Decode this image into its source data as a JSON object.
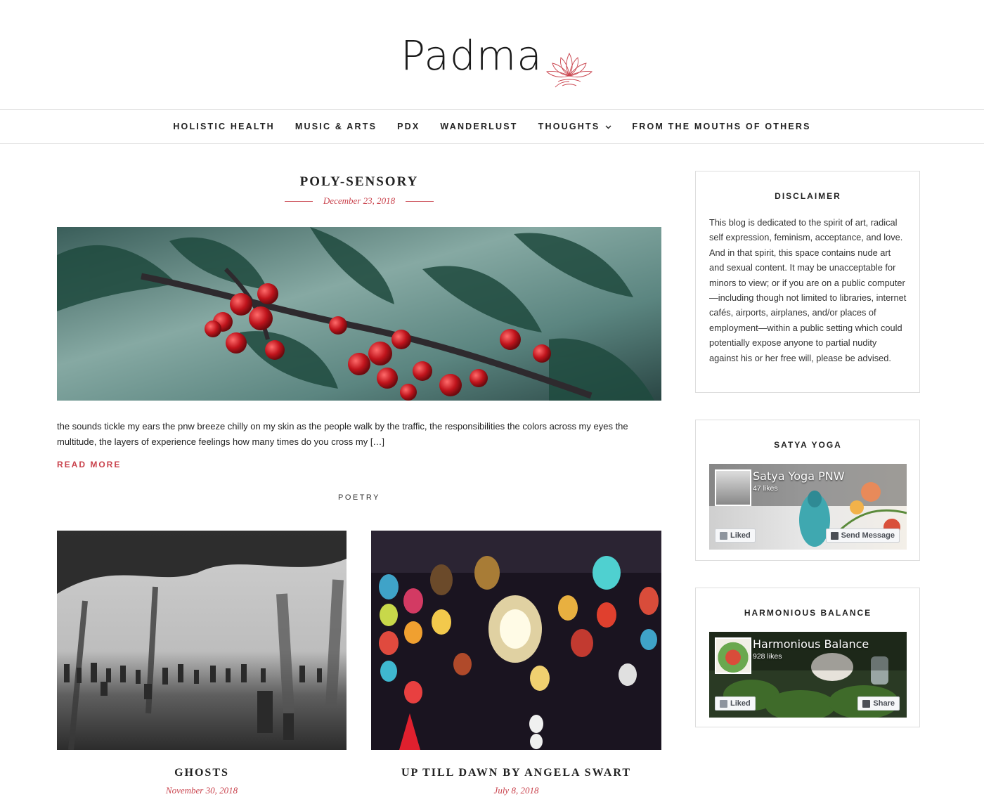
{
  "site": {
    "logo_text": "Padma"
  },
  "nav": {
    "items": [
      {
        "label": "HOLISTIC HEALTH"
      },
      {
        "label": "MUSIC & ARTS"
      },
      {
        "label": "PDX"
      },
      {
        "label": "WANDERLUST"
      },
      {
        "label": "THOUGHTS",
        "has_dropdown": true
      },
      {
        "label": "FROM THE MOUTHS OF OTHERS"
      }
    ]
  },
  "featured_post": {
    "title": "POLY-SENSORY",
    "date": "December 23, 2018",
    "excerpt": "the sounds tickle my ears the pnw breeze chilly on my skin as the people walk by the traffic, the responsibilities the colors across my eyes the multitude, the layers of experience feelings how many times do you cross my […]",
    "read_more": "READ MORE",
    "category": "POETRY"
  },
  "posts": [
    {
      "title": "GHOSTS",
      "date": "November 30, 2018"
    },
    {
      "title": "UP TILL DAWN BY ANGELA SWART",
      "date": "July 8, 2018"
    }
  ],
  "sidebar": {
    "disclaimer": {
      "heading": "DISCLAIMER",
      "text": "This blog is dedicated to the spirit of art, radical self expression, feminism, acceptance, and love. And in that spirit, this space contains nude art and sexual content. It may be unacceptable for minors to view; or if you are on a public computer—including though not limited to libraries, internet cafés, airports, airplanes, and/or places of employment—within a public setting which could potentially expose anyone to partial nudity against his or her free will, please be advised."
    },
    "satya": {
      "heading": "SATYA YOGA",
      "page_name": "Satya Yoga PNW",
      "likes": "47 likes",
      "liked_label": "Liked",
      "action_label": "Send Message"
    },
    "harmonious": {
      "heading": "HARMONIOUS BALANCE",
      "page_name": "Harmonious Balance",
      "likes": "928 likes",
      "liked_label": "Liked",
      "action_label": "Share"
    }
  },
  "colors": {
    "accent": "#c9424c",
    "text": "#222222",
    "border": "#dddddd"
  }
}
